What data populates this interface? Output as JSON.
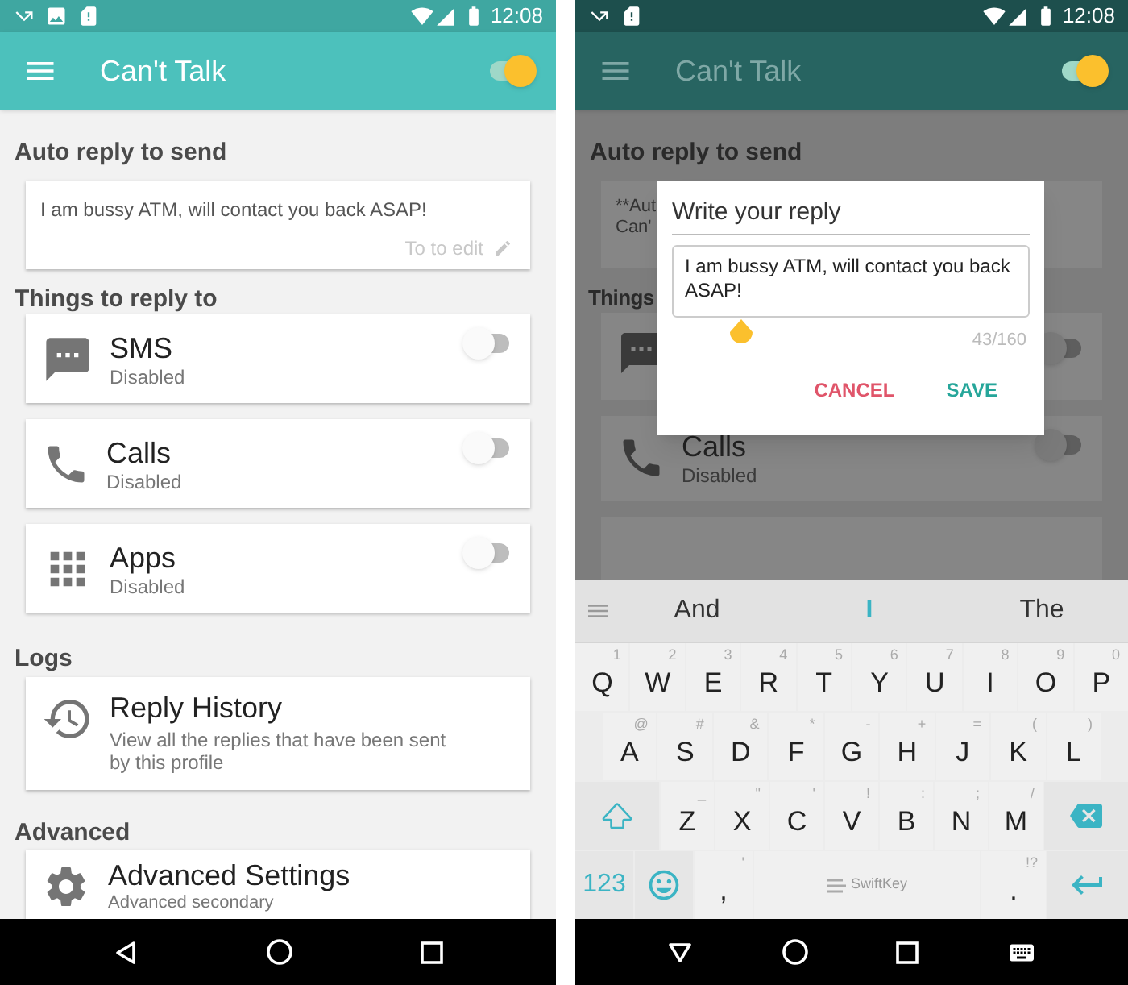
{
  "left_screen": {
    "status_bar": {
      "time": "12:08"
    },
    "app_bar": {
      "title": "Can't Talk",
      "enabled": true
    },
    "auto_reply": {
      "heading": "Auto reply to send",
      "message": "I am bussy ATM, will contact you back ASAP!",
      "hint": "To to edit"
    },
    "things_heading": "Things to reply to",
    "channels": [
      {
        "kind": "sms",
        "name": "SMS",
        "status": "Disabled",
        "on": false
      },
      {
        "kind": "calls",
        "name": "Calls",
        "status": "Disabled",
        "on": false
      },
      {
        "kind": "apps",
        "name": "Apps",
        "status": "Disabled",
        "on": false
      }
    ],
    "logs": {
      "heading": "Logs",
      "title": "Reply History",
      "description": "View all the replies that have been sent by this profile"
    },
    "advanced": {
      "heading": "Advanced",
      "title": "Advanced Settings",
      "description": "Advanced secondary"
    }
  },
  "right_screen": {
    "status_bar": {
      "time": "12:08"
    },
    "app_bar": {
      "title": "Can't Talk",
      "enabled": true
    },
    "background": {
      "heading": "Auto reply to send",
      "card_line_1": "**Aut",
      "card_line_2": "Can'",
      "things_heading": "Things",
      "sms": {
        "on": false
      },
      "calls": {
        "name": "Calls",
        "status": "Disabled",
        "on": false
      }
    },
    "dialog": {
      "title": "Write your reply",
      "value": "I am bussy ATM, will contact you back ASAP!",
      "counter": "43/160",
      "buttons": [
        {
          "label": "CANCEL",
          "kind": "cancel"
        },
        {
          "label": "SAVE",
          "kind": "save"
        }
      ]
    },
    "keyboard": {
      "suggestions": [
        {
          "text": "And",
          "selected": false
        },
        {
          "text": "I",
          "selected": true
        },
        {
          "text": "The",
          "selected": false
        }
      ],
      "rows": [
        [
          {
            "main": "Q",
            "hint": "1"
          },
          {
            "main": "W",
            "hint": "2"
          },
          {
            "main": "E",
            "hint": "3"
          },
          {
            "main": "R",
            "hint": "4"
          },
          {
            "main": "T",
            "hint": "5"
          },
          {
            "main": "Y",
            "hint": "6"
          },
          {
            "main": "U",
            "hint": "7"
          },
          {
            "main": "I",
            "hint": "8"
          },
          {
            "main": "O",
            "hint": "9"
          },
          {
            "main": "P",
            "hint": "0"
          }
        ],
        [
          {
            "main": "A",
            "hint": "@"
          },
          {
            "main": "S",
            "hint": "#"
          },
          {
            "main": "D",
            "hint": "&"
          },
          {
            "main": "F",
            "hint": "*"
          },
          {
            "main": "G",
            "hint": "-"
          },
          {
            "main": "H",
            "hint": "+"
          },
          {
            "main": "J",
            "hint": "="
          },
          {
            "main": "K",
            "hint": "("
          },
          {
            "main": "L",
            "hint": ")"
          }
        ],
        [
          {
            "main": "Z",
            "hint": "_"
          },
          {
            "main": "X",
            "hint": "\""
          },
          {
            "main": "C",
            "hint": "'"
          },
          {
            "main": "V",
            "hint": "!"
          },
          {
            "main": "B",
            "hint": ":"
          },
          {
            "main": "N",
            "hint": ";"
          },
          {
            "main": "M",
            "hint": "/"
          }
        ]
      ],
      "numbers_key": "123",
      "comma_key": {
        "main": ",",
        "hint": "'"
      },
      "space_key": "SwiftKey",
      "period_key": {
        "main": ".",
        "hint": "!?"
      }
    }
  }
}
